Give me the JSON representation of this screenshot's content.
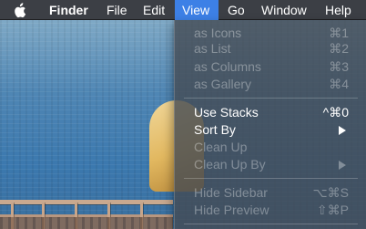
{
  "menubar": {
    "apple_icon": "apple-logo-icon",
    "app_name": "Finder",
    "menus": [
      "File",
      "Edit",
      "View",
      "Go",
      "Window",
      "Help"
    ],
    "active_menu": "View",
    "highlight_color": "#3d80e6"
  },
  "view_menu": {
    "items": [
      {
        "label": "as Icons",
        "shortcut": "⌘1",
        "enabled": false
      },
      {
        "label": "as List",
        "shortcut": "⌘2",
        "enabled": false
      },
      {
        "label": "as Columns",
        "shortcut": "⌘3",
        "enabled": false
      },
      {
        "label": "as Gallery",
        "shortcut": "⌘4",
        "enabled": false
      },
      {
        "label": "Use Stacks",
        "shortcut": "^⌘0",
        "enabled": true
      },
      {
        "label": "Sort By",
        "shortcut": "",
        "submenu": true,
        "enabled": true
      },
      {
        "label": "Clean Up",
        "shortcut": "",
        "enabled": false
      },
      {
        "label": "Clean Up By",
        "shortcut": "",
        "submenu": true,
        "enabled": false
      },
      {
        "label": "Hide Sidebar",
        "shortcut": "⌥⌘S",
        "enabled": false
      },
      {
        "label": "Hide Preview",
        "shortcut": "⇧⌘P",
        "enabled": false
      }
    ]
  }
}
